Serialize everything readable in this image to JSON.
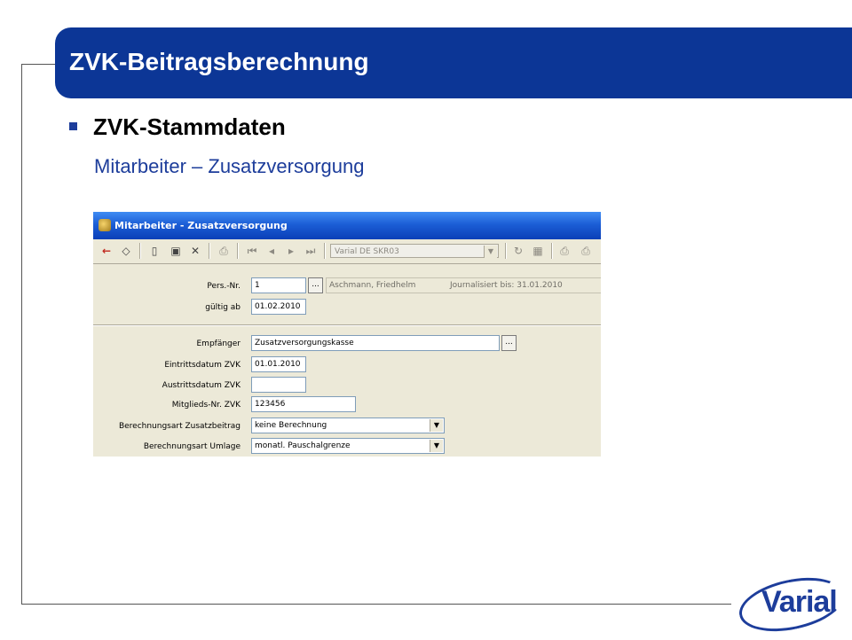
{
  "slide": {
    "title": "ZVK-Beitragsberechnung",
    "heading": "ZVK-Stammdaten",
    "subheading": "Mitarbeiter – Zusatzversorgung",
    "logo_text": "Varial"
  },
  "window": {
    "title": "Mitarbeiter - Zusatzversorgung",
    "toolbar": {
      "combo_value": "Varial DE SKR03",
      "icons": [
        "back-arrow-icon",
        "eraser-icon",
        "new-document-icon",
        "save-icon",
        "delete-icon",
        "print-icon",
        "first-record-icon",
        "previous-record-icon",
        "next-record-icon",
        "last-record-icon",
        "refresh-icon",
        "grid-icon",
        "print-preview-icon",
        "print-setup-icon"
      ]
    },
    "form": {
      "pers_nr_label": "Pers.-Nr.",
      "pers_nr_value": "1",
      "employee_name": "Aschmann, Friedhelm",
      "journal_info": "Journalisiert bis: 31.01.2010",
      "gueltig_ab_label": "gültig ab",
      "gueltig_ab_value": "01.02.2010",
      "empfaenger_label": "Empfänger",
      "empfaenger_value": "Zusatzversorgungskasse",
      "eintritt_label": "Eintrittsdatum ZVK",
      "eintritt_value": "01.01.2010",
      "austritt_label": "Austrittsdatum ZVK",
      "austritt_value": "",
      "mitglieds_label": "Mitglieds-Nr. ZVK",
      "mitglieds_value": "123456",
      "berechnung_zusatz_label": "Berechnungsart Zusatzbeitrag",
      "berechnung_zusatz_value": "keine Berechnung",
      "berechnung_umlage_label": "Berechnungsart Umlage",
      "berechnung_umlage_value": "monatl. Pauschalgrenze",
      "dots_label": "..."
    }
  }
}
